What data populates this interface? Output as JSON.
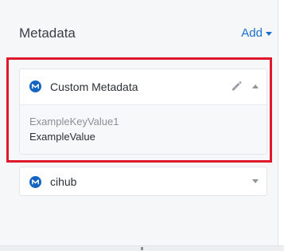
{
  "header": {
    "title": "Metadata",
    "add_label": "Add"
  },
  "cards": [
    {
      "title": "Custom Metadata",
      "badge_icon": "m-logo-icon",
      "expanded": true,
      "edit_icon": "pencil-icon",
      "toggle_icon": "chevron-up-icon",
      "entries": [
        {
          "key": "ExampleKeyValue1",
          "value": "ExampleValue"
        }
      ]
    },
    {
      "title": "cihub",
      "badge_icon": "m-logo-icon",
      "expanded": false,
      "toggle_icon": "chevron-down-icon"
    }
  ],
  "colors": {
    "accent": "#1a6fc9",
    "badge": "#1565c0",
    "highlight": "#e0182b",
    "panel_bg": "#f6f7f8"
  }
}
